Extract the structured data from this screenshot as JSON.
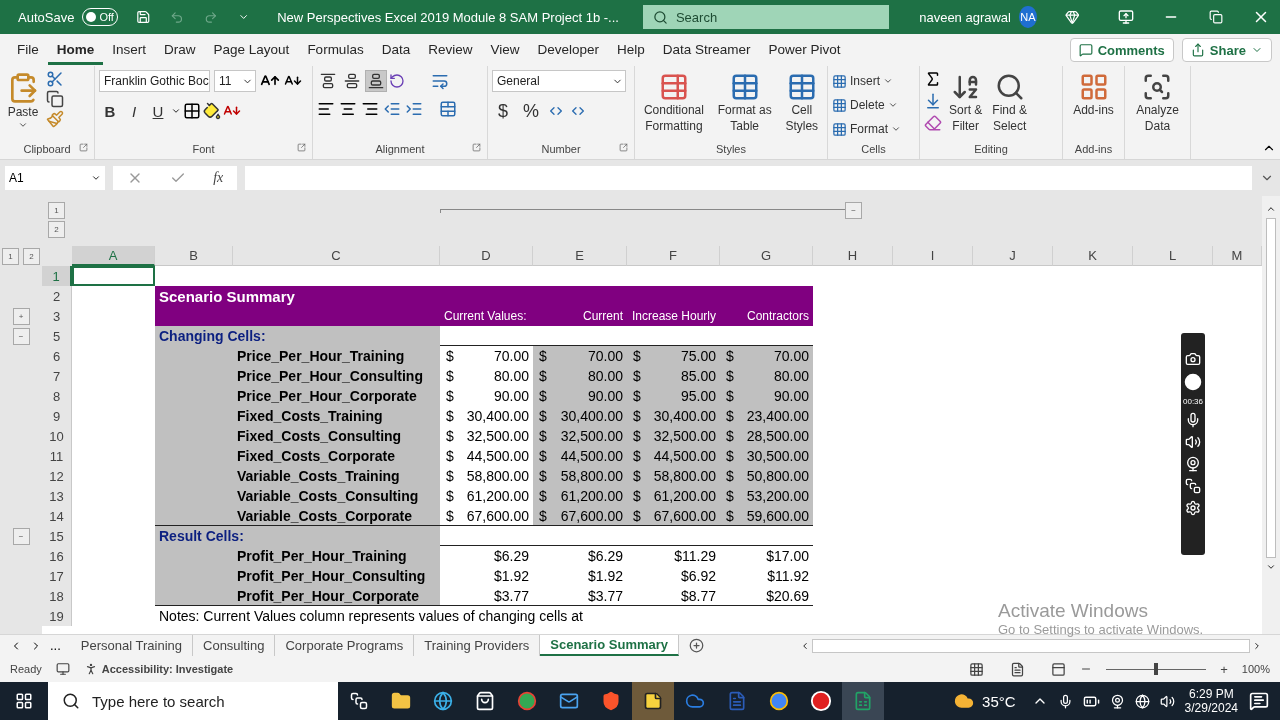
{
  "title_bar": {
    "autosave_label": "AutoSave",
    "autosave_on": false,
    "autosave_state": "Off",
    "document_title": "New Perspectives Excel 2019  Module 8 SAM Project 1b  -...",
    "search_placeholder": "Search",
    "user_name": "naveen agrawal",
    "user_initials": "NA"
  },
  "ribbon_tabs": [
    {
      "label": "File",
      "selected": false
    },
    {
      "label": "Home",
      "selected": true
    },
    {
      "label": "Insert",
      "selected": false
    },
    {
      "label": "Draw",
      "selected": false
    },
    {
      "label": "Page Layout",
      "selected": false
    },
    {
      "label": "Formulas",
      "selected": false
    },
    {
      "label": "Data",
      "selected": false
    },
    {
      "label": "Review",
      "selected": false
    },
    {
      "label": "View",
      "selected": false
    },
    {
      "label": "Developer",
      "selected": false
    },
    {
      "label": "Help",
      "selected": false
    },
    {
      "label": "Data Streamer",
      "selected": false
    },
    {
      "label": "Power Pivot",
      "selected": false
    }
  ],
  "ribbon_actions": {
    "comments": "Comments",
    "share": "Share"
  },
  "ribbon": {
    "paste": "Paste",
    "font_name": "Franklin Gothic Boc",
    "font_size": "11",
    "format_letters": [
      "B",
      "I",
      "U"
    ],
    "vertical_align_buttons": [
      {
        "selected": false
      },
      {
        "selected": false
      },
      {
        "selected": true
      }
    ],
    "number_format": "General",
    "number_symbols": [
      "$",
      "%"
    ],
    "styles": [
      [
        "Conditional",
        "Formatting"
      ],
      [
        "Format as",
        "Table"
      ],
      [
        "Cell",
        "Styles"
      ]
    ],
    "cells": [
      "Insert",
      "Delete",
      "Format"
    ],
    "editing": [
      [
        "Sort &",
        "Filter"
      ],
      [
        "Find &",
        "Select"
      ]
    ],
    "addins": "Add-ins",
    "analyze": [
      "Analyze",
      "Data"
    ],
    "group_labels": [
      "Clipboard",
      "Font",
      "Alignment",
      "Number",
      "Styles",
      "Cells",
      "Editing",
      "Add-ins"
    ]
  },
  "formula_bar": {
    "name_box": "A1",
    "fx": "fx"
  },
  "outline_levels": [
    "1",
    "2"
  ],
  "column_outline_toggle": "−",
  "row_outline_levels": [
    "1",
    "2"
  ],
  "sheet": {
    "columns": [
      {
        "label": "A",
        "selected": true
      },
      {
        "label": "B",
        "selected": false
      },
      {
        "label": "C",
        "selected": false
      },
      {
        "label": "D",
        "selected": false
      },
      {
        "label": "E",
        "selected": false
      },
      {
        "label": "F",
        "selected": false
      },
      {
        "label": "G",
        "selected": false
      },
      {
        "label": "H",
        "selected": false
      },
      {
        "label": "I",
        "selected": false
      },
      {
        "label": "J",
        "selected": false
      },
      {
        "label": "K",
        "selected": false
      },
      {
        "label": "L",
        "selected": false
      },
      {
        "label": "M",
        "selected": false
      }
    ],
    "rows": [
      {
        "number": "1",
        "selected": true,
        "kind": "blank"
      },
      {
        "number": "2",
        "selected": false,
        "kind": "title",
        "text": "Scenario Summary"
      },
      {
        "number": "3",
        "selected": false,
        "kind": "headers",
        "outline": "+",
        "headers": [
          "Current Values:",
          "Current",
          "Increase Hourly",
          "Contractors"
        ]
      },
      {
        "number": "5",
        "selected": false,
        "kind": "section",
        "outline": "−",
        "text": "Changing Cells:"
      },
      {
        "number": "6",
        "selected": false,
        "kind": "accounting",
        "name": "Price_Per_Hour_Training",
        "values": [
          {
            "symbol": "$",
            "amount": "70.00"
          },
          {
            "symbol": "$",
            "amount": "70.00"
          },
          {
            "symbol": "$",
            "amount": "75.00"
          },
          {
            "symbol": "$",
            "amount": "70.00"
          }
        ]
      },
      {
        "number": "7",
        "selected": false,
        "kind": "accounting",
        "name": "Price_Per_Hour_Consulting",
        "values": [
          {
            "symbol": "$",
            "amount": "80.00"
          },
          {
            "symbol": "$",
            "amount": "80.00"
          },
          {
            "symbol": "$",
            "amount": "85.00"
          },
          {
            "symbol": "$",
            "amount": "80.00"
          }
        ]
      },
      {
        "number": "8",
        "selected": false,
        "kind": "accounting",
        "name": "Price_Per_Hour_Corporate",
        "values": [
          {
            "symbol": "$",
            "amount": "90.00"
          },
          {
            "symbol": "$",
            "amount": "90.00"
          },
          {
            "symbol": "$",
            "amount": "95.00"
          },
          {
            "symbol": "$",
            "amount": "90.00"
          }
        ]
      },
      {
        "number": "9",
        "selected": false,
        "kind": "accounting",
        "name": "Fixed_Costs_Training",
        "values": [
          {
            "symbol": "$",
            "amount": "30,400.00"
          },
          {
            "symbol": "$",
            "amount": "30,400.00"
          },
          {
            "symbol": "$",
            "amount": "30,400.00"
          },
          {
            "symbol": "$",
            "amount": "23,400.00"
          }
        ]
      },
      {
        "number": "10",
        "selected": false,
        "kind": "accounting",
        "name": "Fixed_Costs_Consulting",
        "values": [
          {
            "symbol": "$",
            "amount": "32,500.00"
          },
          {
            "symbol": "$",
            "amount": "32,500.00"
          },
          {
            "symbol": "$",
            "amount": "32,500.00"
          },
          {
            "symbol": "$",
            "amount": "28,500.00"
          }
        ]
      },
      {
        "number": "11",
        "selected": false,
        "kind": "accounting",
        "name": "Fixed_Costs_Corporate",
        "values": [
          {
            "symbol": "$",
            "amount": "44,500.00"
          },
          {
            "symbol": "$",
            "amount": "44,500.00"
          },
          {
            "symbol": "$",
            "amount": "44,500.00"
          },
          {
            "symbol": "$",
            "amount": "30,500.00"
          }
        ]
      },
      {
        "number": "12",
        "selected": false,
        "kind": "accounting",
        "name": "Variable_Costs_Training",
        "values": [
          {
            "symbol": "$",
            "amount": "58,800.00"
          },
          {
            "symbol": "$",
            "amount": "58,800.00"
          },
          {
            "symbol": "$",
            "amount": "58,800.00"
          },
          {
            "symbol": "$",
            "amount": "50,800.00"
          }
        ]
      },
      {
        "number": "13",
        "selected": false,
        "kind": "accounting",
        "name": "Variable_Costs_Consulting",
        "values": [
          {
            "symbol": "$",
            "amount": "61,200.00"
          },
          {
            "symbol": "$",
            "amount": "61,200.00"
          },
          {
            "symbol": "$",
            "amount": "61,200.00"
          },
          {
            "symbol": "$",
            "amount": "53,200.00"
          }
        ]
      },
      {
        "number": "14",
        "selected": false,
        "kind": "accounting",
        "name": "Variable_Costs_Corporate",
        "values": [
          {
            "symbol": "$",
            "amount": "67,600.00"
          },
          {
            "symbol": "$",
            "amount": "67,600.00"
          },
          {
            "symbol": "$",
            "amount": "67,600.00"
          },
          {
            "symbol": "$",
            "amount": "59,600.00"
          }
        ]
      },
      {
        "number": "15",
        "selected": false,
        "kind": "section",
        "outline": "−",
        "text": "Result Cells:"
      },
      {
        "number": "16",
        "selected": false,
        "kind": "result",
        "name": "Profit_Per_Hour_Training",
        "values": [
          "$6.29",
          "$6.29",
          "$11.29",
          "$17.00"
        ]
      },
      {
        "number": "17",
        "selected": false,
        "kind": "result",
        "name": "Profit_Per_Hour_Consulting",
        "values": [
          "$1.92",
          "$1.92",
          "$6.92",
          "$11.92"
        ]
      },
      {
        "number": "18",
        "selected": false,
        "kind": "result",
        "name": "Profit_Per_Hour_Corporate",
        "values": [
          "$3.77",
          "$3.77",
          "$8.77",
          "$20.69"
        ]
      },
      {
        "number": "19",
        "selected": false,
        "kind": "note",
        "text": "Notes:  Current Values column represents values of changing cells at"
      }
    ]
  },
  "activation_notice": {
    "title": "Activate Windows",
    "message": "Go to Settings to activate Windows."
  },
  "recorder": {
    "timer": "00:36"
  },
  "sheet_tabs": [
    {
      "label": "Personal Training",
      "selected": false
    },
    {
      "label": "Consulting",
      "selected": false
    },
    {
      "label": "Corporate Programs",
      "selected": false
    },
    {
      "label": "Training Providers",
      "selected": false
    },
    {
      "label": "Scenario Summary",
      "selected": true
    }
  ],
  "sheet_tab_overflow": "...",
  "status_bar": {
    "mode": "Ready",
    "accessibility": "Accessibility: Investigate",
    "zoom_slider": {
      "level": 0.5
    },
    "zoom_in": "+",
    "zoom": "100%"
  },
  "taskbar": {
    "search_placeholder": "Type here to search",
    "temperature": "35°C",
    "time": "6:29 PM",
    "date": "3/29/2024"
  }
}
